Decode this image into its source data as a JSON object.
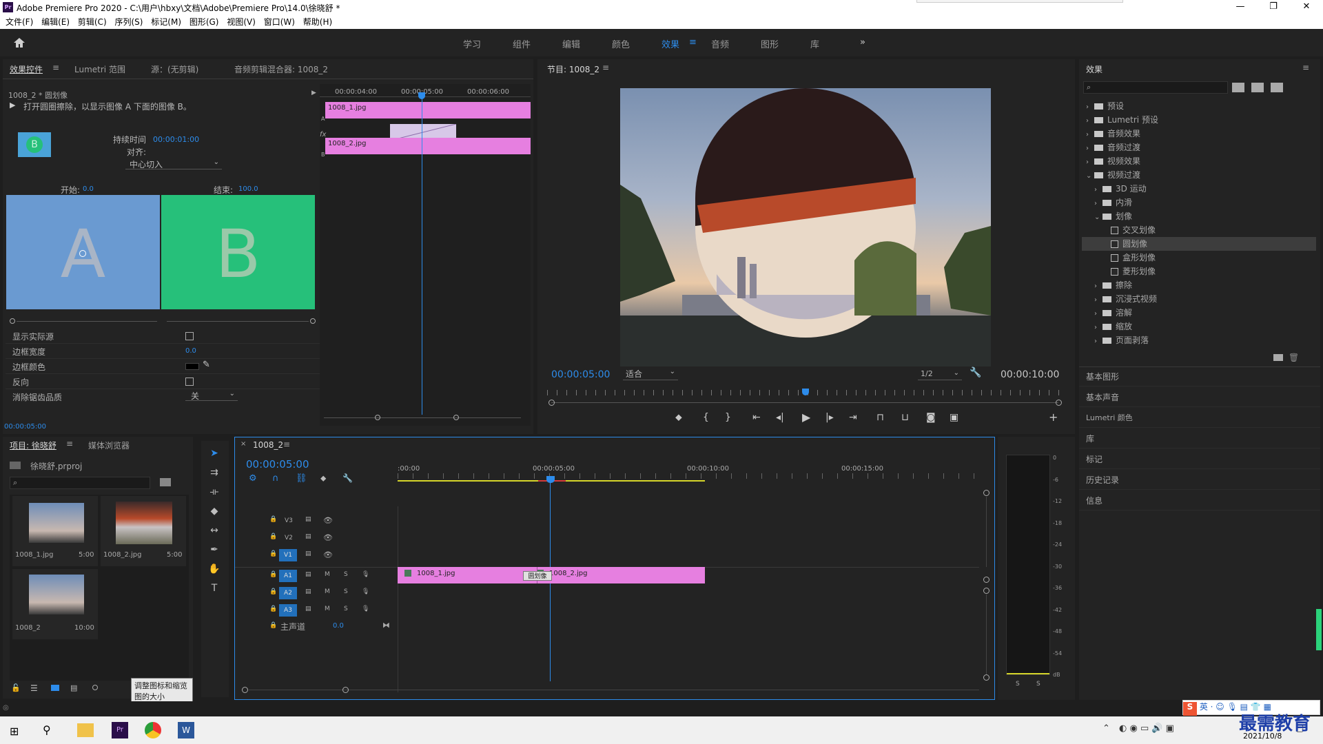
{
  "window": {
    "title": "Adobe Premiere Pro 2020 - C:\\用户\\hbxy\\文档\\Adobe\\Premiere Pro\\14.0\\徐晓舒 *",
    "app_icon": "Pr"
  },
  "menu": [
    "文件(F)",
    "编辑(E)",
    "剪辑(C)",
    "序列(S)",
    "标记(M)",
    "图形(G)",
    "视图(V)",
    "窗口(W)",
    "帮助(H)"
  ],
  "workspaces": [
    "学习",
    "组件",
    "编辑",
    "颜色",
    "效果",
    "音频",
    "图形",
    "库"
  ],
  "active_workspace": "效果",
  "effect_controls": {
    "tabs": [
      "效果控件",
      "Lumetri 范围",
      "源：(无剪辑)",
      "音频剪辑混合器: 1008_2"
    ],
    "clip": "1008_2 * 圆划像",
    "description": "打开圆圈擦除，以显示图像 A 下面的图像 B。",
    "duration_label": "持续时间",
    "duration": "00:00:01:00",
    "align_label": "对齐:",
    "align_value": "中心切入",
    "start_label": "开始:",
    "start_value": "0.0",
    "end_label": "结束:",
    "end_value": "100.0",
    "a_letter": "A",
    "b_letter": "B",
    "icon_letter": "B",
    "props": [
      "显示实际源",
      "边框宽度",
      "边框颜色",
      "反向",
      "消除锯齿品质"
    ],
    "border_width": "0.0",
    "aa_value": "关",
    "timecodes": [
      "00:00:04:00",
      "00:00:05:00",
      "00:00:06:00"
    ],
    "clip_a": "1008_1.jpg",
    "clip_b": "1008_2.jpg",
    "track_a": "A",
    "track_b": "B",
    "fx": "fx",
    "current": "00:00:05:00"
  },
  "program": {
    "title": "节目: 1008_2",
    "current": "00:00:05:00",
    "fit": "适合",
    "resolution": "1/2",
    "duration": "00:00:10:00"
  },
  "effects": {
    "title": "效果",
    "tree": [
      {
        "label": "预设",
        "level": 0,
        "type": "folder",
        "open": false
      },
      {
        "label": "Lumetri 预设",
        "level": 0,
        "type": "folder",
        "open": false
      },
      {
        "label": "音频效果",
        "level": 0,
        "type": "folder",
        "open": false
      },
      {
        "label": "音频过渡",
        "level": 0,
        "type": "folder",
        "open": false
      },
      {
        "label": "视频效果",
        "level": 0,
        "type": "folder",
        "open": false
      },
      {
        "label": "视频过渡",
        "level": 0,
        "type": "folder",
        "open": true
      },
      {
        "label": "3D 运动",
        "level": 1,
        "type": "folder",
        "open": false
      },
      {
        "label": "内滑",
        "level": 1,
        "type": "folder",
        "open": false
      },
      {
        "label": "划像",
        "level": 1,
        "type": "folder",
        "open": true
      },
      {
        "label": "交叉划像",
        "level": 2,
        "type": "fx"
      },
      {
        "label": "圆划像",
        "level": 2,
        "type": "fx",
        "selected": true
      },
      {
        "label": "盒形划像",
        "level": 2,
        "type": "fx"
      },
      {
        "label": "菱形划像",
        "level": 2,
        "type": "fx"
      },
      {
        "label": "擦除",
        "level": 1,
        "type": "folder",
        "open": false
      },
      {
        "label": "沉浸式视频",
        "level": 1,
        "type": "folder",
        "open": false
      },
      {
        "label": "溶解",
        "level": 1,
        "type": "folder",
        "open": false
      },
      {
        "label": "缩放",
        "level": 1,
        "type": "folder",
        "open": false
      },
      {
        "label": "页面剥落",
        "level": 1,
        "type": "folder",
        "open": false
      }
    ],
    "panels": [
      "基本图形",
      "基本声音",
      "Lumetri 颜色",
      "库",
      "标记",
      "历史记录",
      "信息"
    ]
  },
  "project": {
    "tabs": [
      "项目: 徐晓舒",
      "媒体浏览器"
    ],
    "file": "徐晓舒.prproj",
    "items": [
      {
        "name": "1008_1.jpg",
        "dur": "5:00"
      },
      {
        "name": "1008_2.jpg",
        "dur": "5:00"
      },
      {
        "name": "1008_2",
        "dur": "10:00"
      }
    ],
    "tooltip": "调整图标和缩览图的大小"
  },
  "timeline": {
    "tab": "1008_2",
    "current": "00:00:05:00",
    "ruler": [
      ":00:00",
      "00:00:05:00",
      "00:00:10:00",
      "00:00:15:00"
    ],
    "tracks_video": [
      "V3",
      "V2",
      "V1"
    ],
    "tracks_audio": [
      "A1",
      "A2",
      "A3"
    ],
    "master": "主声道",
    "master_val": "0.0",
    "clip1": "1008_1.jpg",
    "clip2": "1008_2.jpg",
    "transition": "圆划像",
    "m": "M",
    "s": "S"
  },
  "meter": {
    "ticks": [
      "0",
      "-6",
      "-12",
      "-18",
      "-24",
      "-30",
      "-36",
      "-42",
      "-48",
      "-54",
      "dB"
    ],
    "s": "S"
  },
  "taskbar": {
    "date": "2021/10/8",
    "ime": "英",
    "watermark": "最需教育"
  }
}
